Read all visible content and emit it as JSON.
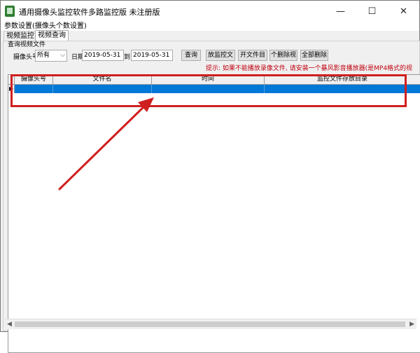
{
  "window": {
    "title": "通用摄像头监控软件多路监控版 未注册版",
    "controls": {
      "minimize": "—",
      "maximize": "☐",
      "close": "✕"
    }
  },
  "menu": {
    "settings": "参数设置(摄像头个数设置)"
  },
  "tabs": [
    {
      "label": "视频监控",
      "selected": false
    },
    {
      "label": "视频查询",
      "selected": true
    }
  ],
  "query": {
    "group_label": "查询视频文件",
    "camera_label": "摄像头号",
    "camera_value": "所有",
    "date_label": "日期",
    "date_from": "2019-05-31",
    "to_label": "到",
    "date_to": "2019-05-31",
    "buttons": {
      "query": "查询",
      "play": "放监控文",
      "open": "开文件目",
      "delete": "个删除视",
      "delete_all": "全部删除"
    },
    "hint": "提示: 如果不能播放录像文件, 请安装一个暴风影音播放器(是MP4格式的视"
  },
  "table": {
    "columns": [
      "摄像头号",
      "文件名",
      "时间",
      "监控文件存放目录"
    ],
    "row_indicator": "▶",
    "rows": [
      [
        "",
        "",
        "",
        ""
      ]
    ]
  },
  "annotation": {
    "color": "#d01f1f"
  },
  "colors": {
    "selection": "#0078d7",
    "hint": "#c0000f"
  }
}
